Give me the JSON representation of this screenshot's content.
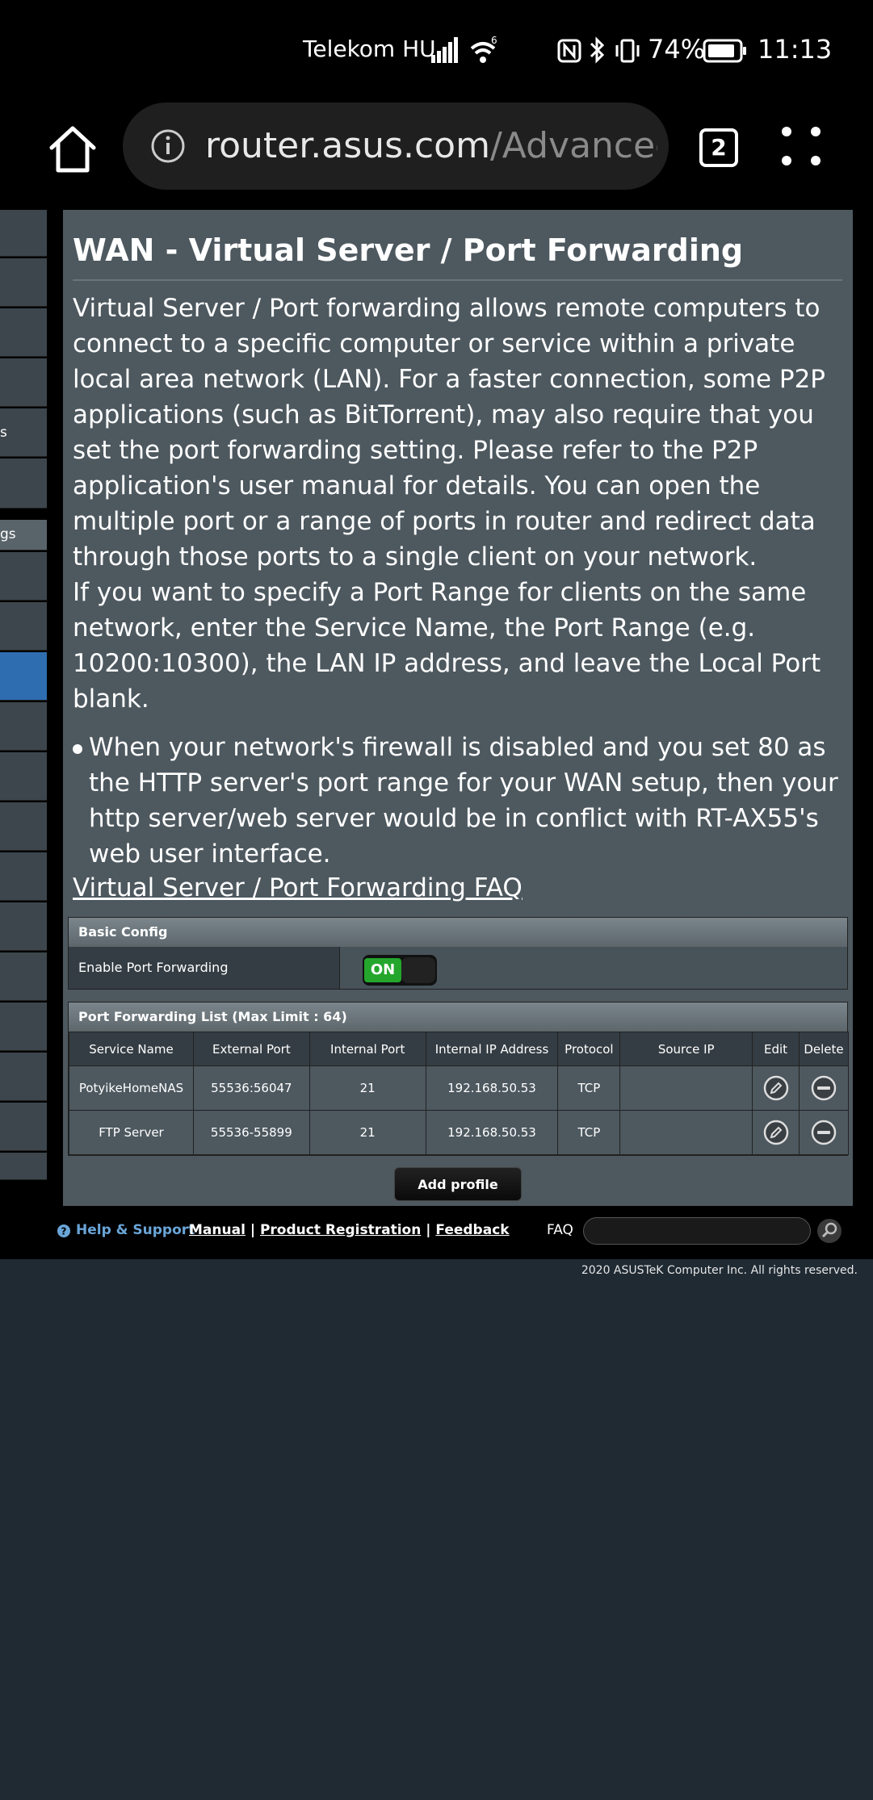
{
  "status_bar": {
    "carrier": "Telekom HU",
    "network_badge": "6",
    "battery_percent": "74%",
    "time": "11:13"
  },
  "browser": {
    "url_host": "router.asus.com",
    "url_path": "/Advanced_",
    "tab_count": "2"
  },
  "sidebar": {
    "partial_labels": [
      "s",
      "gs"
    ]
  },
  "page": {
    "title": "WAN - Virtual Server / Port Forwarding",
    "description": "Virtual Server / Port forwarding allows remote computers to connect to a specific computer or service within a private local area network (LAN). For a faster connection, some P2P applications (such as BitTorrent), may also require that you set the port forwarding setting. Please refer to the P2P application's user manual for details. You can open the multiple port or a range of ports in router and redirect data through those ports to a single client on your network.",
    "description2": "If you want to specify a Port Range for clients on the same network, enter the Service Name, the Port Range (e.g. 10200:10300), the LAN IP address, and leave the Local Port blank.",
    "bullet": "When your network's firewall is disabled and you set 80 as the HTTP server's port range for your WAN setup, then your http server/web server would be in conflict with RT-AX55's web user interface.",
    "faq_link": "Virtual Server / Port Forwarding FAQ"
  },
  "basic_config": {
    "header": "Basic Config",
    "enable_label": "Enable Port Forwarding",
    "toggle_state": "ON"
  },
  "pf_list": {
    "header": "Port Forwarding List (Max Limit : 64)",
    "columns": {
      "service_name": "Service Name",
      "external_port": "External Port",
      "internal_port": "Internal Port",
      "internal_ip": "Internal IP Address",
      "protocol": "Protocol",
      "source_ip": "Source IP",
      "edit": "Edit",
      "delete": "Delete"
    },
    "rows": [
      {
        "service_name": "PotyikeHomeNAS",
        "external_port": "55536:56047",
        "internal_port": "21",
        "internal_ip": "192.168.50.53",
        "protocol": "TCP",
        "source_ip": ""
      },
      {
        "service_name": "FTP Server",
        "external_port": "55536-55899",
        "internal_port": "21",
        "internal_ip": "192.168.50.53",
        "protocol": "TCP",
        "source_ip": ""
      }
    ],
    "add_button": "Add profile"
  },
  "footer": {
    "help": "Help & Support",
    "manual": "Manual",
    "product_registration": "Product Registration",
    "feedback": "Feedback",
    "sep": "|",
    "faq_label": "FAQ",
    "faq_placeholder": "",
    "copyright": "2020 ASUSTeK Computer Inc. All rights reserved."
  },
  "colors": {
    "panel": "#4d585f",
    "page_bg": "#1f2a33",
    "toggle_on": "#24a62d",
    "help_link": "#6aa5d8",
    "sidebar_selected": "#2e6db0"
  },
  "icons": {
    "home": "home-icon",
    "info": "info-icon",
    "menu": "more-vert-icon",
    "edit": "pencil-icon",
    "delete": "minus-circle-icon",
    "help": "question-icon",
    "search": "search-icon"
  }
}
